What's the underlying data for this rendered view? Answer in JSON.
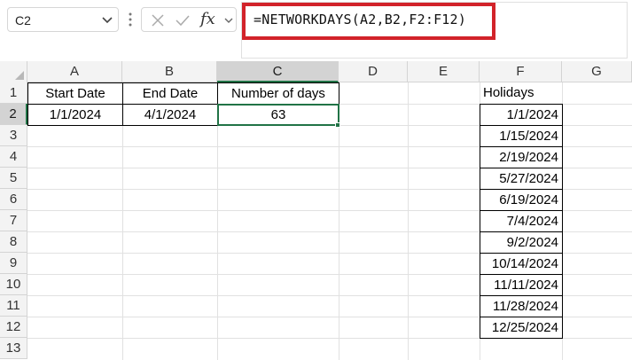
{
  "formula_bar": {
    "name_box": "C2",
    "fx_label": "fx",
    "formula": "=NETWORKDAYS(A2,B2,F2:F12)"
  },
  "columns": [
    "A",
    "B",
    "C",
    "D",
    "E",
    "F",
    "G"
  ],
  "rows": [
    "1",
    "2",
    "3",
    "4",
    "5",
    "6",
    "7",
    "8",
    "9",
    "10",
    "11",
    "12",
    "13"
  ],
  "table": {
    "headers": [
      "Start Date",
      "End Date",
      "Number of days"
    ],
    "values": [
      "1/1/2024",
      "4/1/2024",
      "63"
    ]
  },
  "holidays": {
    "header": "Holidays",
    "dates": [
      "1/1/2024",
      "1/15/2024",
      "2/19/2024",
      "5/27/2024",
      "6/19/2024",
      "7/4/2024",
      "9/2/2024",
      "10/14/2024",
      "11/11/2024",
      "11/28/2024",
      "12/25/2024"
    ]
  },
  "colors": {
    "highlight": "#d2232a",
    "selection": "#217346"
  }
}
